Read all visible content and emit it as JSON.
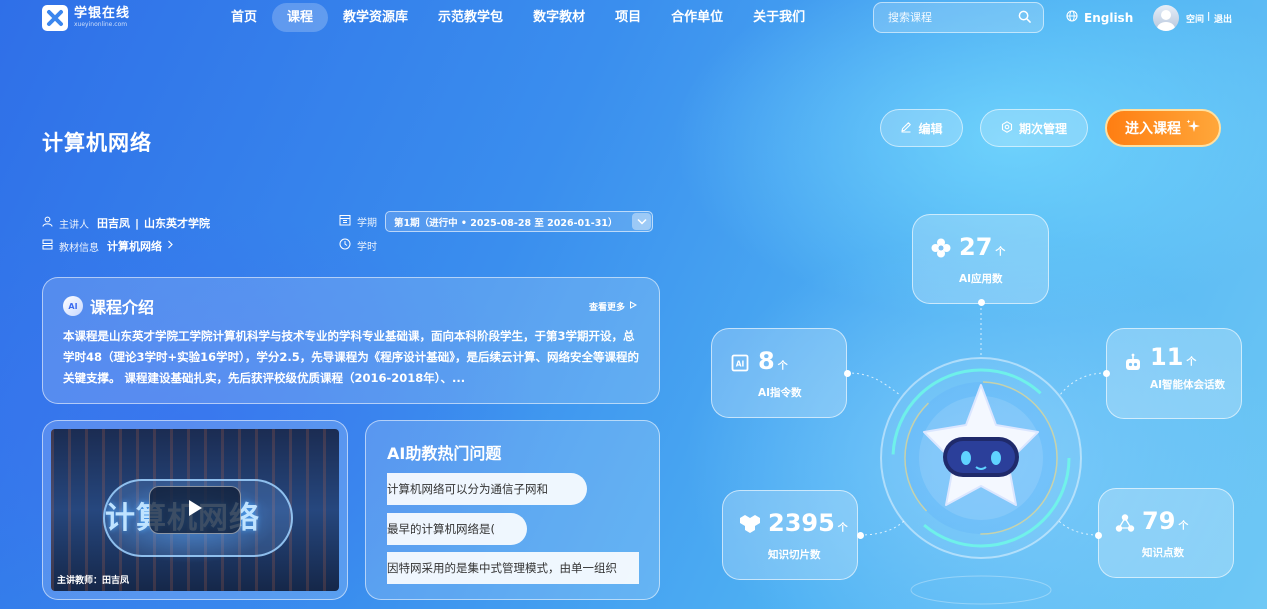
{
  "header": {
    "logo_text": "学银在线",
    "logo_subtext": "xueyinonline.com",
    "nav": [
      {
        "label": "首页",
        "active": false
      },
      {
        "label": "课程",
        "active": true
      },
      {
        "label": "教学资源库",
        "active": false
      },
      {
        "label": "示范教学包",
        "active": false
      },
      {
        "label": "数字教材",
        "active": false
      },
      {
        "label": "项目",
        "active": false
      },
      {
        "label": "合作单位",
        "active": false
      },
      {
        "label": "关于我们",
        "active": false
      }
    ],
    "search_placeholder": "搜索课程",
    "language": "English",
    "user_name": "空间",
    "logout": "退出"
  },
  "course": {
    "title": "计算机网络",
    "actions": {
      "edit": "编辑",
      "term_manage": "期次管理",
      "enter": "进入课程"
    },
    "meta": {
      "lecturer_label": "主讲人",
      "lecturer": "田吉凤",
      "school": "山东英才学院",
      "textbook_label": "教材信息",
      "textbook": "计算机网络",
      "term_label": "学期",
      "term_value": "第1期（进行中 • 2025-08-28 至 2026-01-31）",
      "hours_label": "学时"
    }
  },
  "intro": {
    "title": "课程介绍",
    "ai_badge": "AI",
    "more": "查看更多",
    "text": "本课程是山东英才学院工学院计算机科学与技术专业的学科专业基础课，面向本科阶段学生，于第3学期开设，总学时48（理论3学时+实验16学时），学分2.5，先导课程为《程序设计基础》，是后续云计算、网络安全等课程的关键支撑。 课程建设基础扎实，先后获评校级优质课程（2016-2018年）、..."
  },
  "video": {
    "cover_text": "计算机网络",
    "caption": "主讲教师：田吉凤"
  },
  "hot_questions": {
    "title": "AI助教热门问题",
    "items": [
      "计算机网络可以分为通信子网和",
      "最早的计算机网络是(",
      "因特网采用的是集中式管理模式，由单一组织"
    ]
  },
  "stats": {
    "unit": "个",
    "ai_apps": {
      "value": "27",
      "label": "AI应用数"
    },
    "ai_prompts": {
      "value": "8",
      "label": "AI指令数"
    },
    "ai_agent_sessions": {
      "value": "11",
      "label": "AI智能体会话数"
    },
    "knowledge_slices": {
      "value": "2395",
      "label": "知识切片数"
    },
    "knowledge_points": {
      "value": "79",
      "label": "知识点数"
    }
  },
  "colors": {
    "accent_orange": "#ff8a1e",
    "primary_blue": "#3a8eee"
  }
}
